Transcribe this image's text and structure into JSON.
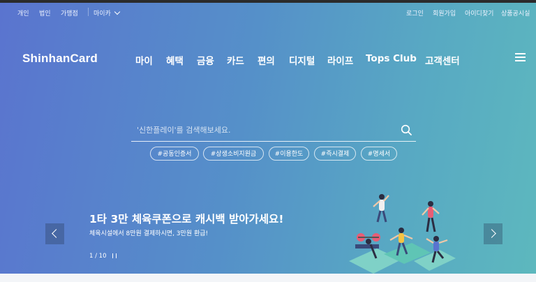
{
  "utility": {
    "left_links": [
      "개인",
      "법인",
      "가맹점"
    ],
    "lang_label": "마이카",
    "right_links": [
      "로그인",
      "회원가입",
      "아이디찾기",
      "상품공시실"
    ]
  },
  "brand": {
    "logo_text": "ShinhanCard"
  },
  "nav": {
    "items": [
      "마이",
      "혜택",
      "금융",
      "카드",
      "편의",
      "디지털",
      "라이프",
      "Tops Club",
      "고객센터"
    ]
  },
  "search": {
    "placeholder": "'신한플레이'를 검색해보세요.",
    "tags": [
      "#공동인증서",
      "#상생소비지원금",
      "#이용한도",
      "#즉시결제",
      "#명세서"
    ]
  },
  "banner": {
    "title": "1타 3만 체육쿠폰으로 캐시백 받아가세요!",
    "subtitle": "체육시설에서 8만원 결제하시면, 3만원 환급!",
    "pager": "1 / 10"
  },
  "icons": [
    "chevron-down-icon",
    "hamburger-menu-icon",
    "search-icon",
    "chevron-left-icon",
    "chevron-right-icon",
    "pause-icon"
  ],
  "colors": {
    "gradient_start": "#5a74cf",
    "gradient_end": "#5db8be"
  }
}
